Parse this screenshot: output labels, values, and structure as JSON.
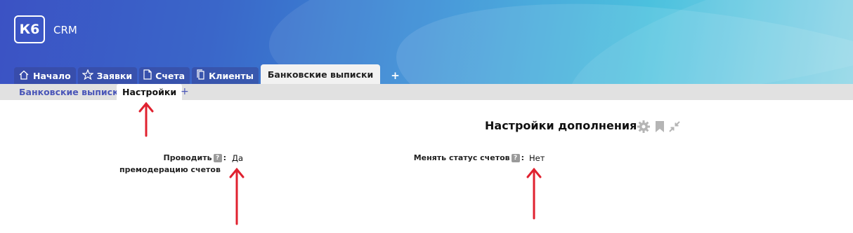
{
  "app": {
    "logo": "К6",
    "name": "CRM"
  },
  "tabs": [
    {
      "label": "Начало",
      "icon": "home-icon"
    },
    {
      "label": "Заявки",
      "icon": "star-icon"
    },
    {
      "label": "Счета",
      "icon": "document-icon"
    },
    {
      "label": "Клиенты",
      "icon": "copy-icon"
    },
    {
      "label": "Банковские выписки",
      "active": true
    }
  ],
  "tab_add": "+",
  "subtabs": [
    {
      "label": "Банковские выписки"
    },
    {
      "label": "Настройки",
      "active": true
    }
  ],
  "subtab_add": "+",
  "panel": {
    "title": "Настройки дополнения",
    "icons": [
      "gear-icon",
      "bookmark-icon",
      "collapse-icon"
    ]
  },
  "fields": [
    {
      "label_line1": "Проводить",
      "label_line2": "премодерацию счетов",
      "help": "?",
      "colon": ":",
      "value": "Да"
    },
    {
      "label_line1": "Менять статус счетов",
      "help": "?",
      "colon": ":",
      "value": "Нет"
    }
  ],
  "colors": {
    "accent": "#4a56b8",
    "arrow": "#e0212f"
  }
}
